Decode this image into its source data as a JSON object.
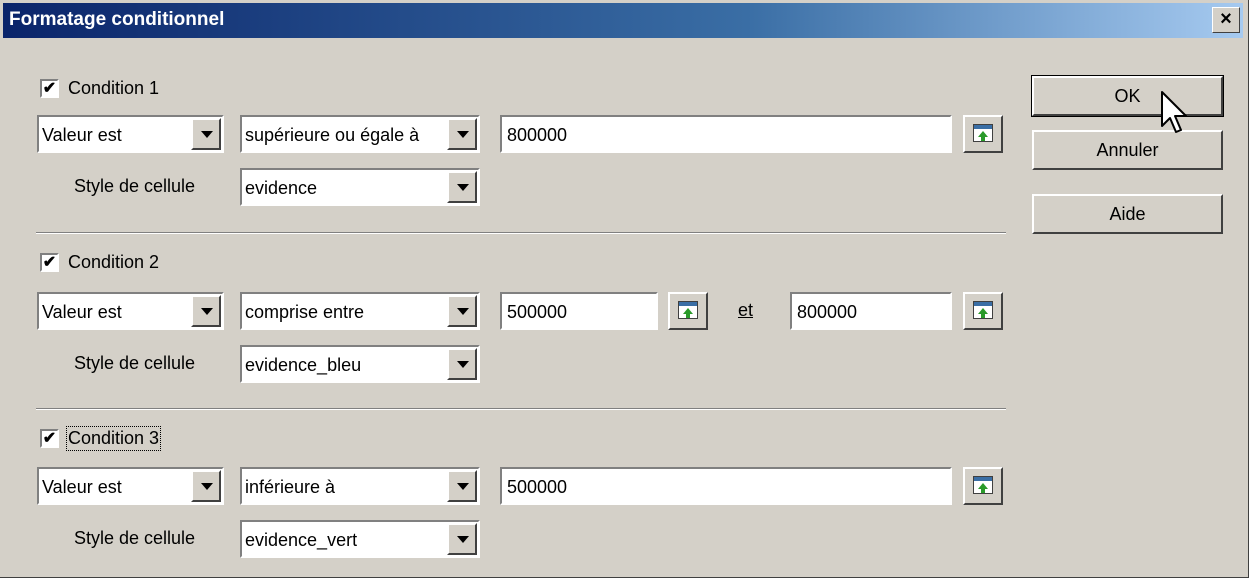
{
  "dialog": {
    "title": "Formatage conditionnel",
    "close_glyph": "×"
  },
  "conditions": [
    {
      "label": "Condition 1",
      "checked": true,
      "type": "Valeur est",
      "operator": "supérieure ou égale à",
      "value1": "800000",
      "and_label": "",
      "value2": "",
      "style_label": "Style de cellule",
      "style": "evidence"
    },
    {
      "label": "Condition 2",
      "checked": true,
      "type": "Valeur est",
      "operator": "comprise entre",
      "value1": "500000",
      "and_label": "et",
      "value2": "800000",
      "style_label": "Style de cellule",
      "style": "evidence_bleu"
    },
    {
      "label": "Condition 3",
      "checked": true,
      "type": "Valeur est",
      "operator": "inférieure à",
      "value1": "500000",
      "and_label": "",
      "value2": "",
      "style_label": "Style de cellule",
      "style": "evidence_vert"
    }
  ],
  "buttons": {
    "ok": "OK",
    "cancel": "Annuler",
    "help": "Aide"
  },
  "icons": {
    "checkbox_checked": "check-icon",
    "shrink": "shrink-dialog-icon",
    "cursor": "mouse-pointer-icon"
  }
}
